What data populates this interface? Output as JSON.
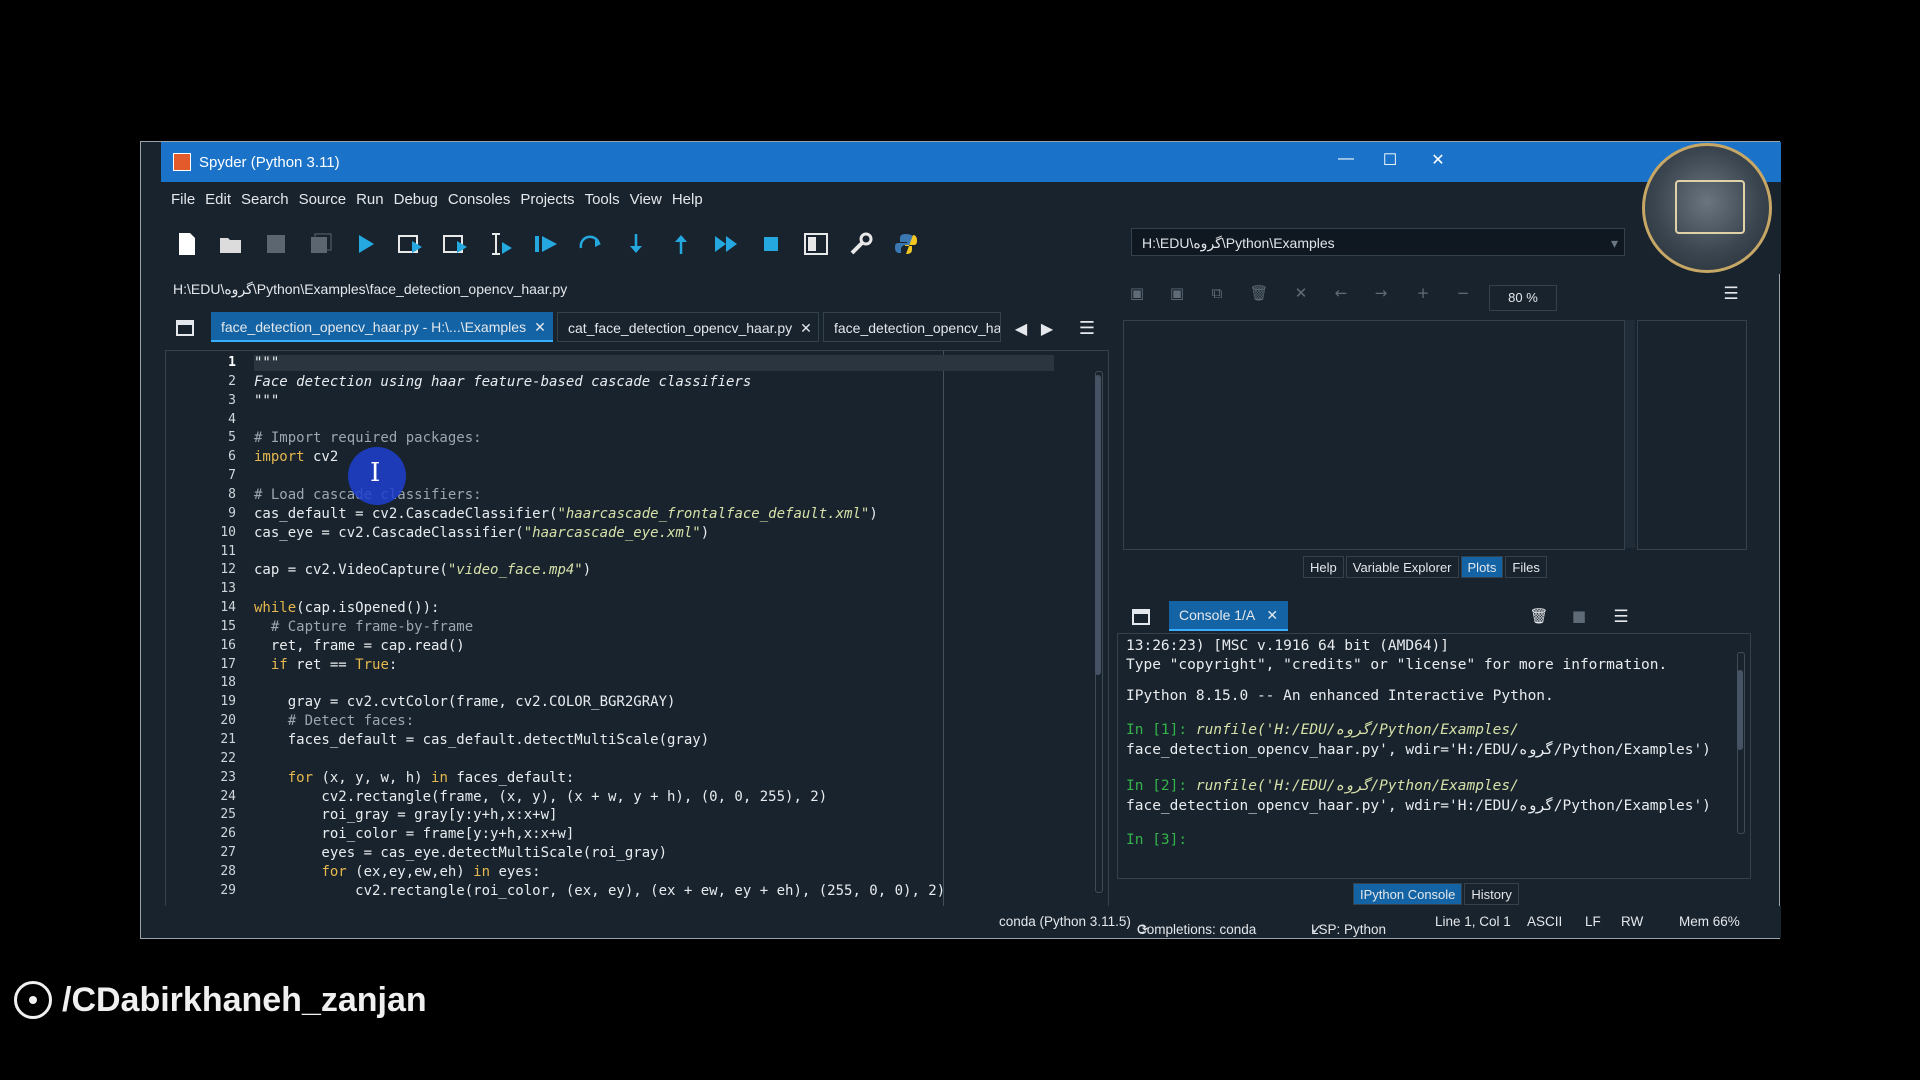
{
  "window": {
    "title": "Spyder (Python 3.11)",
    "minimize": "—",
    "maximize": "☐",
    "close": "✕"
  },
  "menu": [
    "File",
    "Edit",
    "Search",
    "Source",
    "Run",
    "Debug",
    "Consoles",
    "Projects",
    "Tools",
    "View",
    "Help"
  ],
  "toolbar": {
    "icons": [
      "new-file-icon",
      "open-file-icon",
      "save-icon",
      "save-all-icon",
      "run-icon",
      "run-cell-icon",
      "run-cell-advance-icon",
      "run-selection-icon",
      "debug-icon",
      "step-over-icon",
      "step-into-icon",
      "step-return-icon",
      "continue-icon",
      "stop-icon",
      "maximize-pane-icon",
      "preferences-icon",
      "python-path-icon"
    ],
    "working_dir": "H:\\EDU\\گروه\\Python\\Examples"
  },
  "editor": {
    "file_path": "H:\\EDU\\گروه\\Python\\Examples\\face_detection_opencv_haar.py",
    "tabs": [
      {
        "label": "face_detection_opencv_haar.py - H:\\...\\Examples",
        "active": true
      },
      {
        "label": "cat_face_detection_opencv_haar.py",
        "active": false
      },
      {
        "label": "face_detection_opencv_ha",
        "active": false
      }
    ],
    "lines": [
      "\"\"\"",
      "Face detection using haar feature-based cascade classifiers",
      "\"\"\"",
      "",
      "# Import required packages:",
      "import cv2",
      "",
      "# Load cascade classifiers:",
      "cas_default = cv2.CascadeClassifier(\"haarcascade_frontalface_default.xml\")",
      "cas_eye = cv2.CascadeClassifier(\"haarcascade_eye.xml\")",
      "",
      "cap = cv2.VideoCapture(\"video_face.mp4\")",
      "",
      "while(cap.isOpened()):",
      "  # Capture frame-by-frame",
      "  ret, frame = cap.read()",
      "  if ret == True:",
      "",
      "    gray = cv2.cvtColor(frame, cv2.COLOR_BGR2GRAY)",
      "    # Detect faces:",
      "    faces_default = cas_default.detectMultiScale(gray)",
      "",
      "    for (x, y, w, h) in faces_default:",
      "        cv2.rectangle(frame, (x, y), (x + w, y + h), (0, 0, 255), 2)",
      "        roi_gray = gray[y:y+h,x:x+w]",
      "        roi_color = frame[y:y+h,x:x+w]",
      "        eyes = cas_eye.detectMultiScale(roi_gray)",
      "        for (ex,ey,ew,eh) in eyes:",
      "            cv2.rectangle(roi_color, (ex, ey), (ex + ew, ey + eh), (255, 0, 0), 2)"
    ],
    "current_line": 1
  },
  "plots": {
    "zoom": "80 %",
    "pane_tabs": [
      "Help",
      "Variable Explorer",
      "Plots",
      "Files"
    ],
    "selected_tab": "Plots"
  },
  "console": {
    "tab": "Console 1/A",
    "lines": {
      "l1": "13:26:23) [MSC v.1916 64 bit (AMD64)]",
      "l2": "Type \"copyright\", \"credits\" or \"license\" for more information.",
      "l3": "IPython 8.15.0 -- An enhanced Interactive Python.",
      "in1_prompt": "In [1]:",
      "in1_a": " runfile('H:/EDU/گروه/Python/Examples/",
      "in1_b": "face_detection_opencv_haar.py', wdir='H:/EDU/گروه/Python/Examples')",
      "in2_prompt": "In [2]:",
      "in2_a": " runfile('H:/EDU/گروه/Python/Examples/",
      "in2_b": "face_detection_opencv_haar.py', wdir='H:/EDU/گروه/Python/Examples')",
      "in3_prompt": "In [3]:"
    },
    "pane_tabs": [
      "IPython Console",
      "History"
    ],
    "selected_tab": "IPython Console"
  },
  "status": {
    "env": "conda (Python 3.11.5)",
    "completions": "Completions: conda",
    "lsp": "LSP: Python",
    "position": "Line 1, Col 1",
    "encoding": "ASCII",
    "eol": "LF",
    "rw": "RW",
    "mem": "Mem 66%"
  },
  "watermark": "/CDabirkhaneh_zanjan"
}
